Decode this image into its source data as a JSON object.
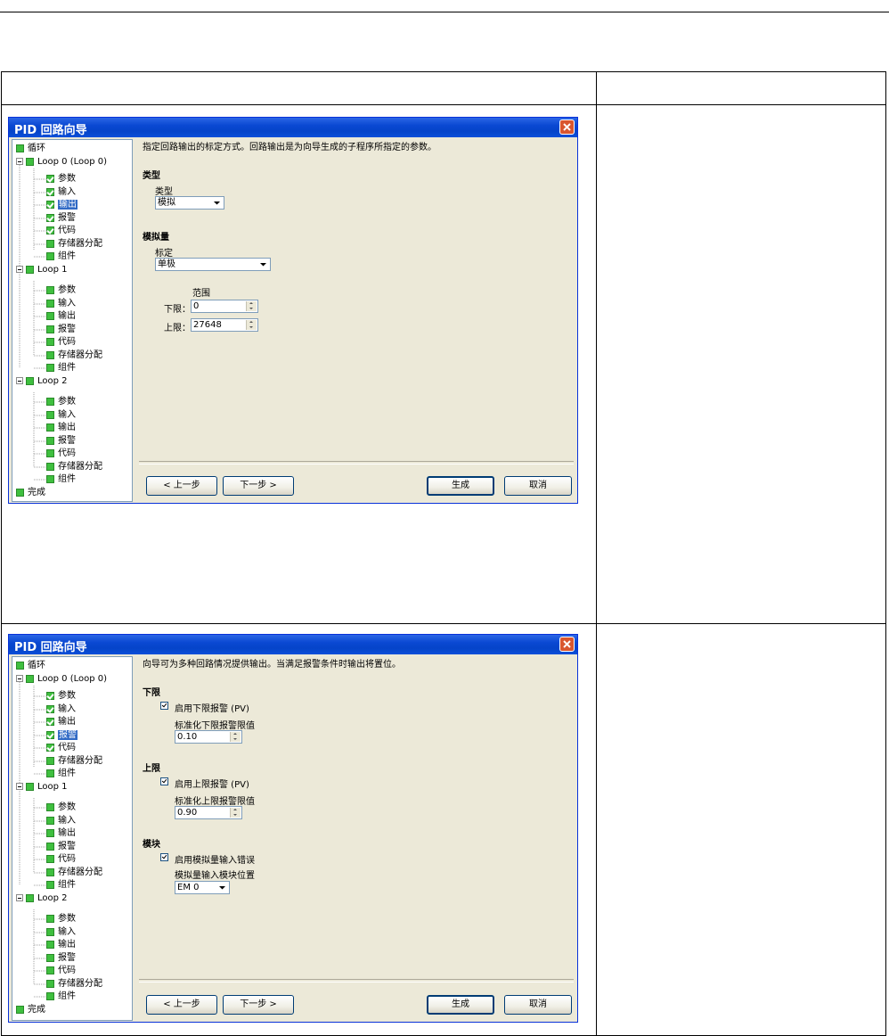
{
  "dialog1": {
    "title": "PID 回路向导",
    "tree": {
      "root": "循环",
      "loop0": "Loop 0 (Loop 0)",
      "loop0_items": [
        "参数",
        "输入",
        "输出",
        "报警",
        "代码",
        "存储器分配",
        "组件"
      ],
      "loop1": "Loop 1",
      "loop1_items": [
        "参数",
        "输入",
        "输出",
        "报警",
        "代码",
        "存储器分配",
        "组件"
      ],
      "loop2": "Loop 2",
      "loop2_items": [
        "参数",
        "输入",
        "输出",
        "报警",
        "代码",
        "存储器分配",
        "组件"
      ],
      "done": "完成"
    },
    "description": "指定回路输出的标定方式。回路输出是为向导生成的子程序所指定的参数。",
    "type_section": "类型",
    "type_label": "类型",
    "type_value": "模拟",
    "analog_section": "模拟量",
    "scaling_label": "标定",
    "scaling_value": "单极",
    "range_label": "范围",
    "low_label": "下限：",
    "low_value": "0",
    "high_label": "上限：",
    "high_value": "27648",
    "buttons": {
      "prev": "< 上一步",
      "next": "下一步 >",
      "generate": "生成",
      "cancel": "取消"
    }
  },
  "dialog2": {
    "title": "PID 回路向导",
    "tree": {
      "root": "循环",
      "loop0": "Loop 0 (Loop 0)",
      "loop0_items": [
        "参数",
        "输入",
        "输出",
        "报警",
        "代码",
        "存储器分配",
        "组件"
      ],
      "loop1": "Loop 1",
      "loop1_items": [
        "参数",
        "输入",
        "输出",
        "报警",
        "代码",
        "存储器分配",
        "组件"
      ],
      "loop2": "Loop 2",
      "loop2_items": [
        "参数",
        "输入",
        "输出",
        "报警",
        "代码",
        "存储器分配",
        "组件"
      ],
      "done": "完成"
    },
    "description": "向导可为多种回路情况提供输出。当满足报警条件时输出将置位。",
    "low_section": "下限",
    "low_enable": "启用下限报警 (PV)",
    "low_limit_label": "标准化下限报警限值",
    "low_limit_value": "0.10",
    "high_section": "上限",
    "high_enable": "启用上限报警 (PV)",
    "high_limit_label": "标准化上限报警限值",
    "high_limit_value": "0.90",
    "module_section": "模块",
    "module_enable": "启用模拟量输入错误",
    "module_pos_label": "模拟量输入模块位置",
    "module_pos_value": "EM 0",
    "buttons": {
      "prev": "< 上一步",
      "next": "下一步 >",
      "generate": "生成",
      "cancel": "取消"
    }
  },
  "colors": {
    "titlebar": "#0a48d2",
    "dialog_bg": "#ece9d8",
    "selection": "#316ac5",
    "tree_icon": "#3fbf3f",
    "close": "#d9562f"
  }
}
